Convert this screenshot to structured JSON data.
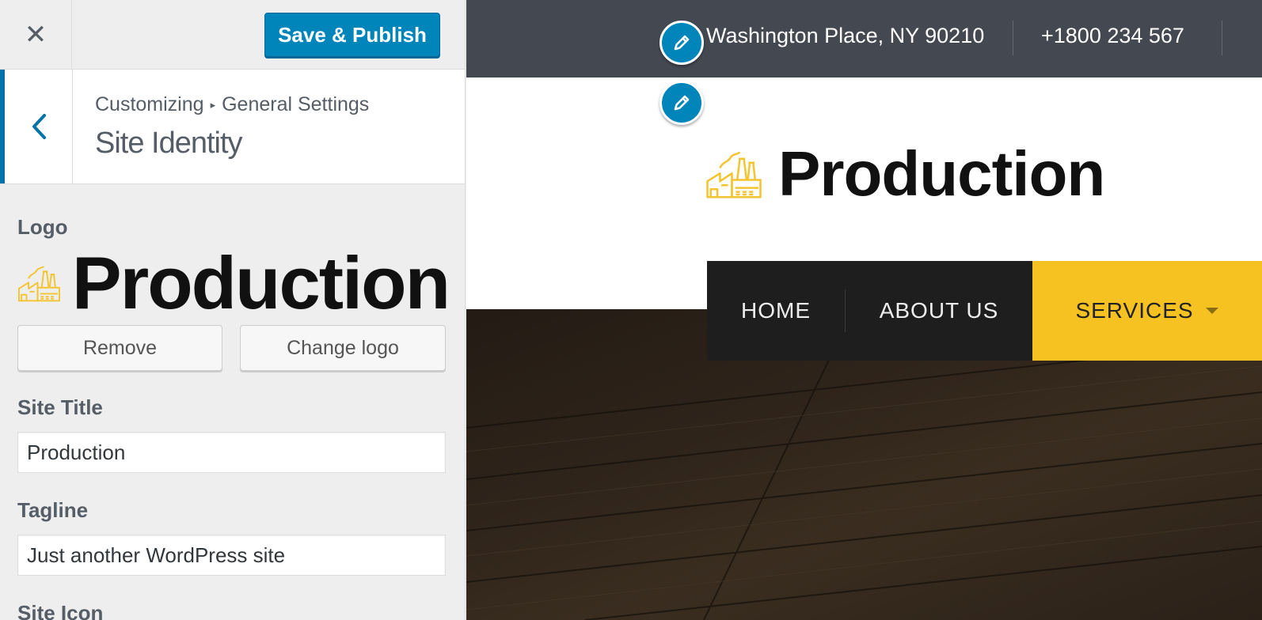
{
  "sidebar": {
    "close_icon": "close-icon",
    "publish_label": "Save & Publish",
    "breadcrumb": {
      "root": "Customizing",
      "separator": "▸",
      "parent": "General Settings"
    },
    "section_title": "Site Identity",
    "logo": {
      "label": "Logo",
      "brand_text": "Production"
    },
    "remove_label": "Remove",
    "change_logo_label": "Change logo",
    "site_title": {
      "label": "Site Title",
      "value": "Production"
    },
    "tagline": {
      "label": "Tagline",
      "value": "Just another WordPress site"
    },
    "site_icon": {
      "label": "Site Icon"
    }
  },
  "preview": {
    "address": "Washington Place, NY 90210",
    "phone": "+1800 234 567",
    "logo_text": "Production",
    "nav": [
      {
        "label": "HOME"
      },
      {
        "label": "ABOUT US"
      },
      {
        "label": "SERVICES"
      }
    ]
  },
  "colors": {
    "accent": "#0085ba",
    "active_nav": "#f6c221",
    "topbar": "#444851",
    "logo_icon": "#f4c430"
  }
}
